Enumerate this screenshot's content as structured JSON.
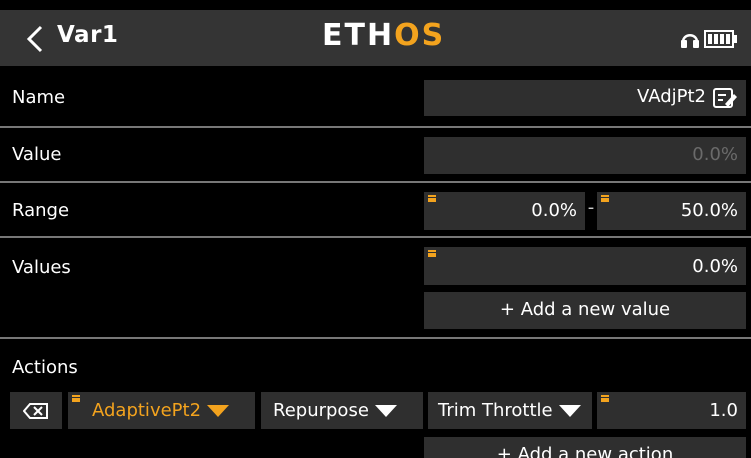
{
  "header": {
    "title": "Var1",
    "logo_main": "ETH",
    "logo_accent": "OS",
    "icons": [
      "back-chevron-icon",
      "headphone-icon",
      "battery-icon"
    ]
  },
  "name_row": {
    "label": "Name",
    "value": "VAdjPt2",
    "icon": "edit-icon"
  },
  "value_row": {
    "label": "Value",
    "value": "0.0%"
  },
  "range_row": {
    "label": "Range",
    "min": "0.0%",
    "separator": "-",
    "max": "50.0%"
  },
  "values_row": {
    "label": "Values",
    "value": "0.0%",
    "add_button": "+ Add a new value"
  },
  "actions_row": {
    "label": "Actions",
    "action": {
      "source": "AdaptivePt2",
      "mode": "Repurpose",
      "target": "Trim Throttle",
      "amount": "1.0"
    },
    "add_button": "+ Add a new action"
  },
  "colors": {
    "accent": "#f3a31e",
    "header_bg": "#343434",
    "field_bg": "#2f2f2f",
    "background": "#000000"
  }
}
